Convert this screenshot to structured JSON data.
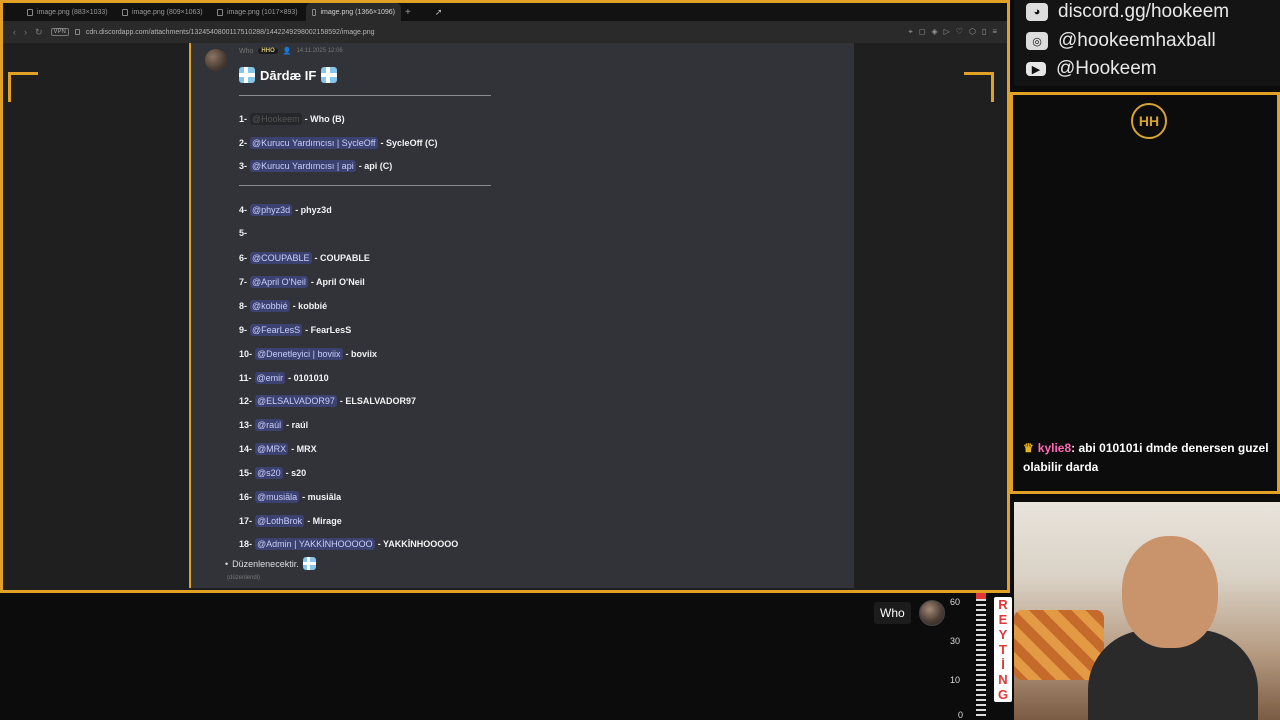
{
  "browser": {
    "tabs": [
      {
        "label": "image.png (883×1033)",
        "active": false
      },
      {
        "label": "image.png (809×1063)",
        "active": false
      },
      {
        "label": "image.png (1017×893)",
        "active": false
      },
      {
        "label": "image.png (1366×1096)",
        "active": true
      }
    ],
    "new_tab": "+",
    "vpn": "VPN",
    "url": "cdn.discordapp.com/attachments/1324540800117510288/1442249298002158592/image.png"
  },
  "message": {
    "author": "Who",
    "badge": "HHO",
    "timestamp": "14.11.2025 12:06",
    "title": "Dārdæ IF",
    "lines": [
      {
        "num": "1-",
        "mention": "@Hookeem",
        "text": "- Who (B)",
        "muted": true
      },
      {
        "num": "2-",
        "mention": "@Kurucu Yardımcısı | SycleOff",
        "text": "- SycleOff (C)"
      },
      {
        "num": "3-",
        "mention": "@Kurucu Yardımcısı | api",
        "text": "- api (C)"
      },
      {
        "num": "4-",
        "mention": "@phyz3d",
        "text": "- phyz3d"
      },
      {
        "num": "5-",
        "mention": "",
        "text": ""
      },
      {
        "num": "6-",
        "mention": "@COUPABLE",
        "text": "- COUPABLE"
      },
      {
        "num": "7-",
        "mention": "@April O'Neil",
        "text": "- April O'Neil"
      },
      {
        "num": "8-",
        "mention": "@kobbié",
        "text": "- kobbié"
      },
      {
        "num": "9-",
        "mention": "@FearLesS",
        "text": "- FearLesS"
      },
      {
        "num": "10-",
        "mention": "@Denetleyici | boviix",
        "text": "- boviix"
      },
      {
        "num": "11-",
        "mention": "@emir",
        "text": "- 0101010"
      },
      {
        "num": "12-",
        "mention": "@ELSALVADOR97",
        "text": "- ELSALVADOR97"
      },
      {
        "num": "13-",
        "mention": "@raúl",
        "text": "- raúl"
      },
      {
        "num": "14-",
        "mention": "@MRX",
        "text": "- MRX"
      },
      {
        "num": "15-",
        "mention": "@s20",
        "text": "- s20"
      },
      {
        "num": "16-",
        "mention": "@musiāla",
        "text": "- musiāla"
      },
      {
        "num": "17-",
        "mention": "@LothBrok",
        "text": "- Mirage"
      },
      {
        "num": "18-",
        "mention": "@Admin | YAKKİNHOOOOO",
        "text": "- YAKKİNHOOOOO"
      }
    ],
    "bullet": "Düzenlenecektir.",
    "edited": "(düzenlendi)"
  },
  "social": {
    "discord": "discord.gg/hookeem",
    "instagram": "@hookeemhaxball",
    "youtube": "@Hookeem"
  },
  "logo_text": "HH",
  "chat": {
    "user": "kylie8",
    "text": ": abi 010101i dmde denersen guzel olabilir darda"
  },
  "overlay": {
    "who_label": "Who",
    "meter_ticks": [
      "60",
      "30",
      "10",
      "0"
    ],
    "rating_letters": [
      "R",
      "E",
      "Y",
      "T",
      "İ",
      "N",
      "G"
    ]
  },
  "colors": {
    "accent": "#e1a126",
    "mention_bg": "#3c4270",
    "mention_text": "#c9cdfb",
    "chat_user": "#ff6ab3",
    "rating": "#e23737"
  }
}
